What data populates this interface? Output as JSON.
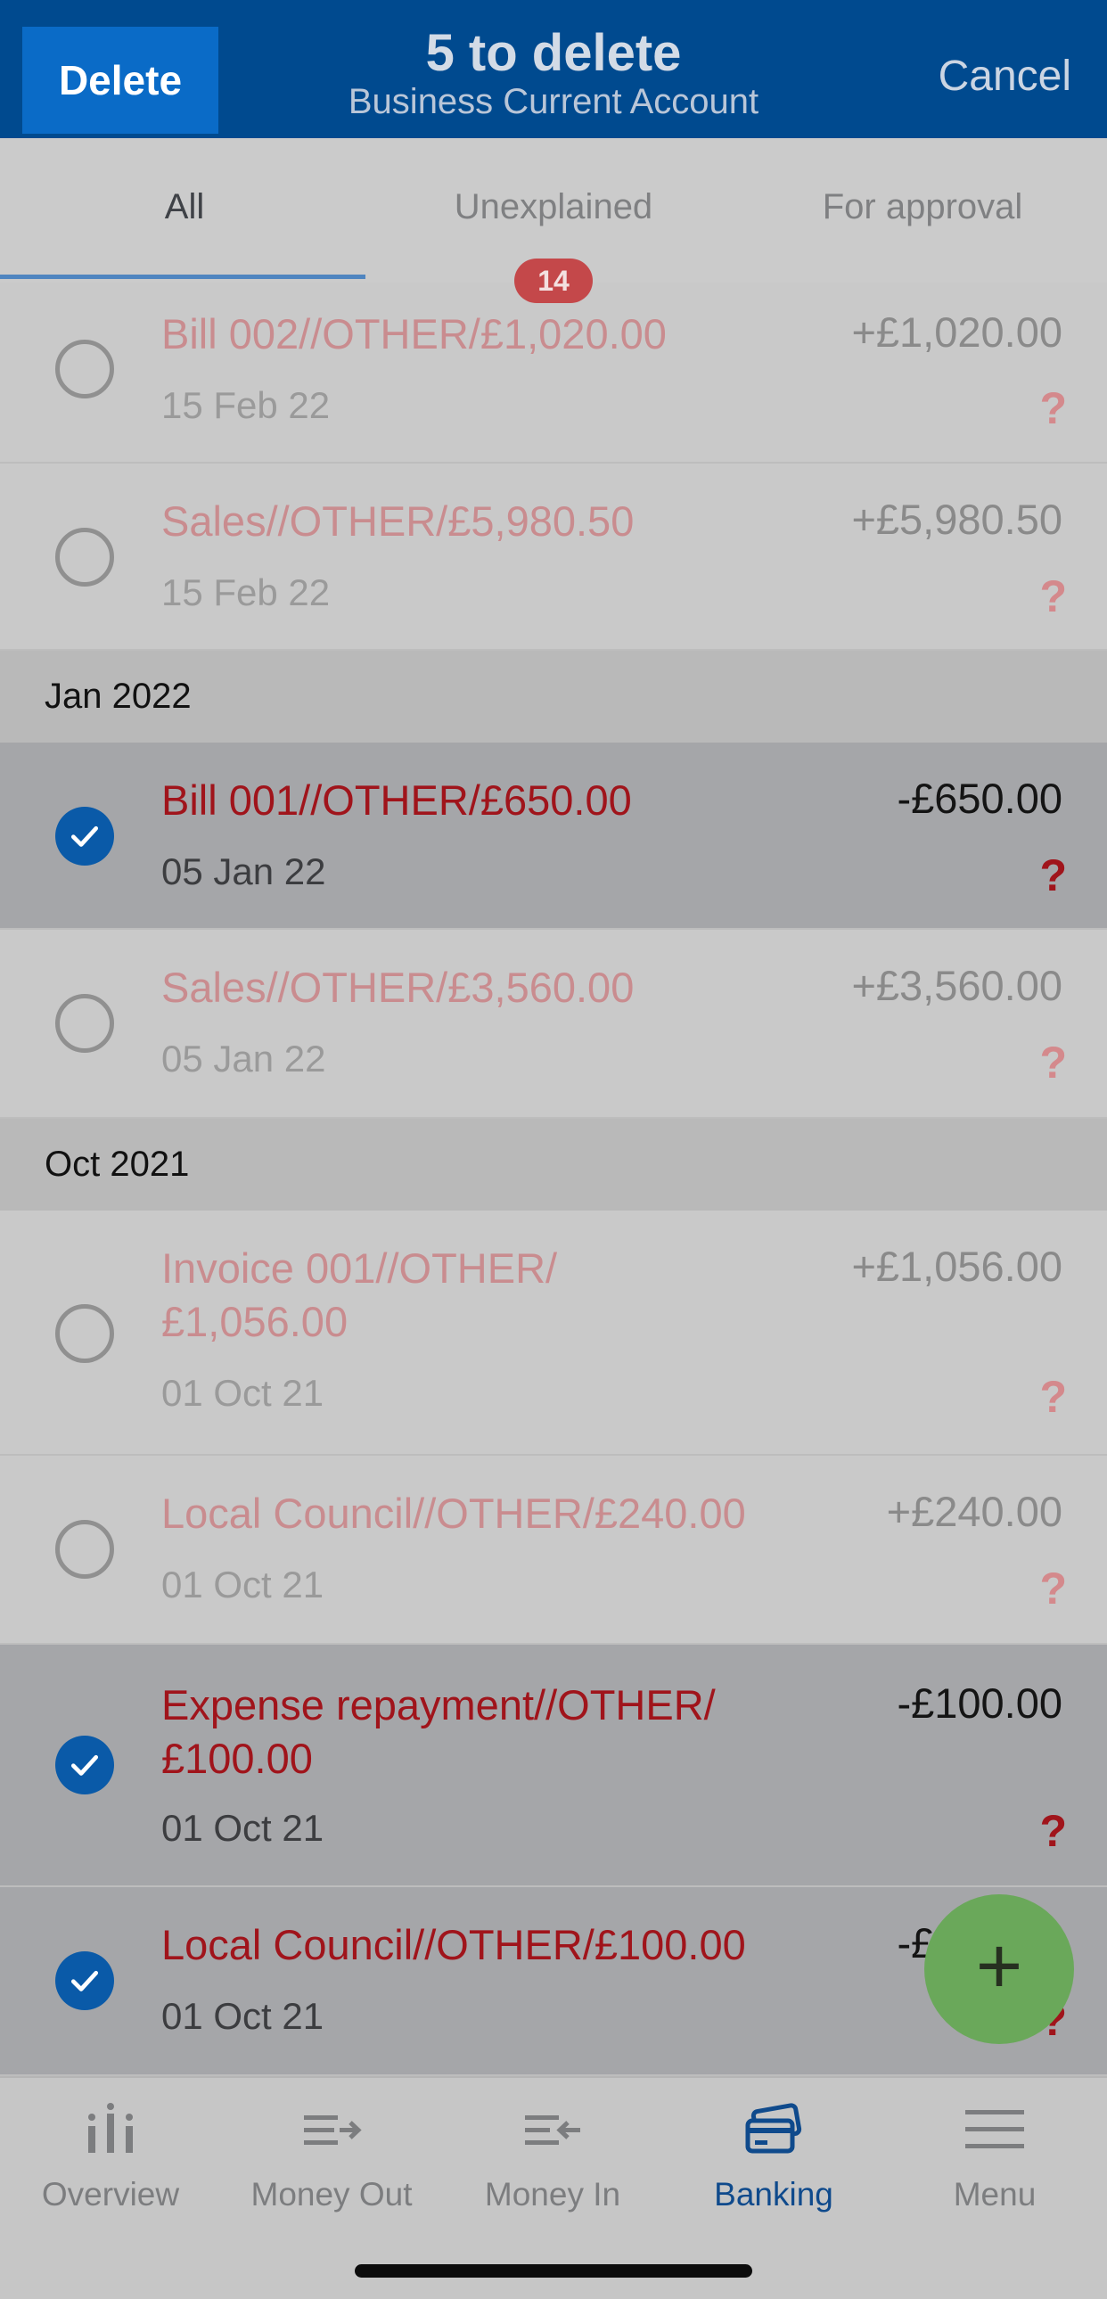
{
  "header": {
    "delete_label": "Delete",
    "title": "5 to delete",
    "subtitle": "Business Current Account",
    "cancel_label": "Cancel"
  },
  "tabs": [
    {
      "label": "All",
      "active": true
    },
    {
      "label": "Unexplained",
      "badge": "14"
    },
    {
      "label": "For approval"
    }
  ],
  "groups": {
    "jan2022": "Jan 2022",
    "oct2021": "Oct 2021"
  },
  "transactions": [
    {
      "description": "Bill 002//OTHER/£1,020.00",
      "date": "15 Feb 22",
      "amount": "+£1,020.00",
      "selected": false,
      "status": "?"
    },
    {
      "description": "Sales//OTHER/£5,980.50",
      "date": "15 Feb 22",
      "amount": "+£5,980.50",
      "selected": false,
      "status": "?"
    },
    {
      "description": "Bill 001//OTHER/£650.00",
      "date": "05 Jan 22",
      "amount": "-£650.00",
      "selected": true,
      "status": "?"
    },
    {
      "description": "Sales//OTHER/£3,560.00",
      "date": "05 Jan 22",
      "amount": "+£3,560.00",
      "selected": false,
      "status": "?"
    },
    {
      "description": "Invoice 001//OTHER/\n£1,056.00",
      "date": "01 Oct 21",
      "amount": "+£1,056.00",
      "selected": false,
      "status": "?"
    },
    {
      "description": "Local Council//OTHER/£240.00",
      "date": "01 Oct 21",
      "amount": "+£240.00",
      "selected": false,
      "status": "?"
    },
    {
      "description": "Expense repayment//OTHER/\n£100.00",
      "date": "01 Oct 21",
      "amount": "-£100.00",
      "selected": true,
      "status": "?"
    },
    {
      "description": "Local Council//OTHER/£100.00",
      "date": "01 Oct 21",
      "amount": "-£100.00",
      "selected": true,
      "status": "?"
    }
  ],
  "fab": {
    "icon": "plus-icon",
    "label": "+"
  },
  "bottom_nav": [
    {
      "label": "Overview",
      "icon": "chart-icon"
    },
    {
      "label": "Money Out",
      "icon": "money-out-icon"
    },
    {
      "label": "Money In",
      "icon": "money-in-icon"
    },
    {
      "label": "Banking",
      "icon": "banking-cards-icon",
      "active": true
    },
    {
      "label": "Menu",
      "icon": "hamburger-menu-icon"
    }
  ],
  "colors": {
    "header_bg": "#004a8f",
    "delete_btn": "#0a6bc7",
    "selected_check": "#0a5aa8",
    "description_red": "#a0141b",
    "fab_green": "#6aa85a",
    "nav_active": "#0f4a8c"
  }
}
